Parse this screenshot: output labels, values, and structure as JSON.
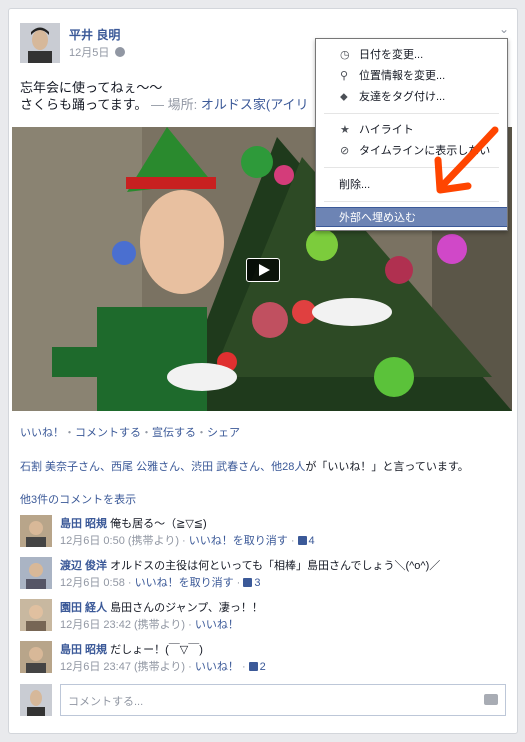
{
  "post": {
    "author": "平井 良明",
    "date": "12月5日",
    "status_line1": "忘年会に使ってねぇ〜〜",
    "status_line2": "さくらも踊ってます。",
    "location_prefix": " — 場所: ",
    "location": "オルドス家(アイリ"
  },
  "actions": {
    "like": "いいね！",
    "comment": "コメントする",
    "promote": "宣伝する",
    "share": "シェア",
    "dot": "・"
  },
  "likers": {
    "names": "石割 美奈子さん、西尾 公雅さん、渋田 武春さん、他28人",
    "suffix": "が「いいね！」と言っています。"
  },
  "more_comments": "他3件のコメントを表示",
  "comments": [
    {
      "name": "島田 昭規",
      "text": "俺も居る〜（≧▽≦)",
      "time": "12月6日 0:50 (携帯より)",
      "action": "いいね！を取り消す",
      "likes": "4"
    },
    {
      "name": "渡辺 俊洋",
      "text": "オルドスの主役は何といっても「相棒」島田さんでしょう＼(^o^)／",
      "time": "12月6日 0:58",
      "action": "いいね！を取り消す",
      "likes": "3"
    },
    {
      "name": "園田 経人",
      "text": "島田さんのジャンプ、凄っ！！",
      "time": "12月6日 23:42 (携帯より)",
      "action": "いいね！",
      "likes": ""
    },
    {
      "name": "島田 昭規",
      "text": "だしょー！(￣▽￣)",
      "time": "12月6日 23:47 (携帯より)",
      "action": "いいね！",
      "likes": "2"
    }
  ],
  "comment_box": {
    "placeholder": "コメントする..."
  },
  "menu": {
    "items": [
      {
        "label": "日付を変更...",
        "icon": "clock-icon"
      },
      {
        "label": "位置情報を変更...",
        "icon": "pin-icon"
      },
      {
        "label": "友達をタグ付け...",
        "icon": "tag-icon"
      },
      {
        "label": "ハイライト",
        "icon": "star-icon"
      },
      {
        "label": "タイムラインに表示しない",
        "icon": "hide-icon"
      },
      {
        "label": "削除...",
        "icon": ""
      },
      {
        "label": "外部へ埋め込む",
        "icon": ""
      }
    ]
  },
  "colors": {
    "link": "#3b5998",
    "highlight": "#6d84b4",
    "arrow": "#ff4500"
  }
}
